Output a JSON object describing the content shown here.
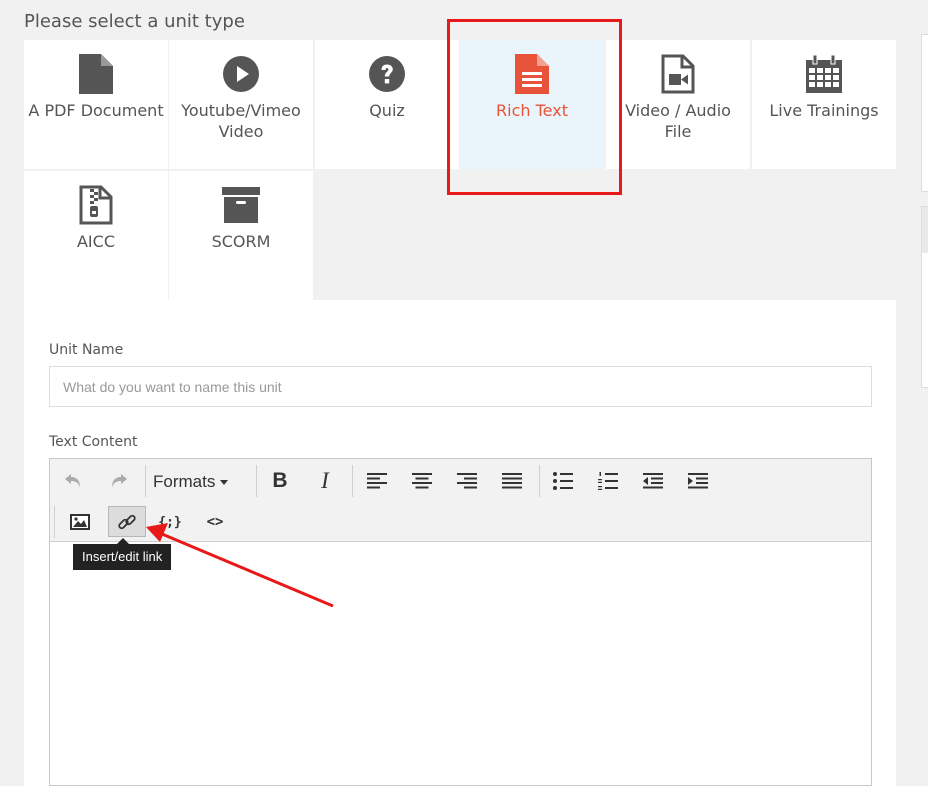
{
  "heading": "Please select a unit type",
  "unit_types": [
    {
      "label": "A PDF Document",
      "icon": "file-icon",
      "selected": false
    },
    {
      "label": "Youtube/Vimeo Video",
      "icon": "play-circle-icon",
      "selected": false
    },
    {
      "label": "Quiz",
      "icon": "question-circle-icon",
      "selected": false
    },
    {
      "label": "Rich Text",
      "icon": "file-text-icon",
      "selected": true
    },
    {
      "label": "Video / Audio File",
      "icon": "file-video-icon",
      "selected": false
    },
    {
      "label": "Live Trainings",
      "icon": "calendar-icon",
      "selected": false
    },
    {
      "label": "AICC",
      "icon": "file-archive-icon",
      "selected": false
    },
    {
      "label": "SCORM",
      "icon": "archive-box-icon",
      "selected": false
    }
  ],
  "form": {
    "unit_name_label": "Unit Name",
    "unit_name_placeholder": "What do you want to name this unit",
    "unit_name_value": "",
    "text_content_label": "Text Content"
  },
  "editor": {
    "formats_label": "Formats",
    "bold_glyph": "B",
    "italic_glyph": "I",
    "variable_glyph": "{;}",
    "code_glyph": "<>",
    "tooltip": "Insert/edit link"
  },
  "colors": {
    "accent": "#e8533a",
    "selected_tile_bg": "#e9f4fb",
    "annotation_red": "#e81919",
    "icon_gray": "#555555"
  }
}
